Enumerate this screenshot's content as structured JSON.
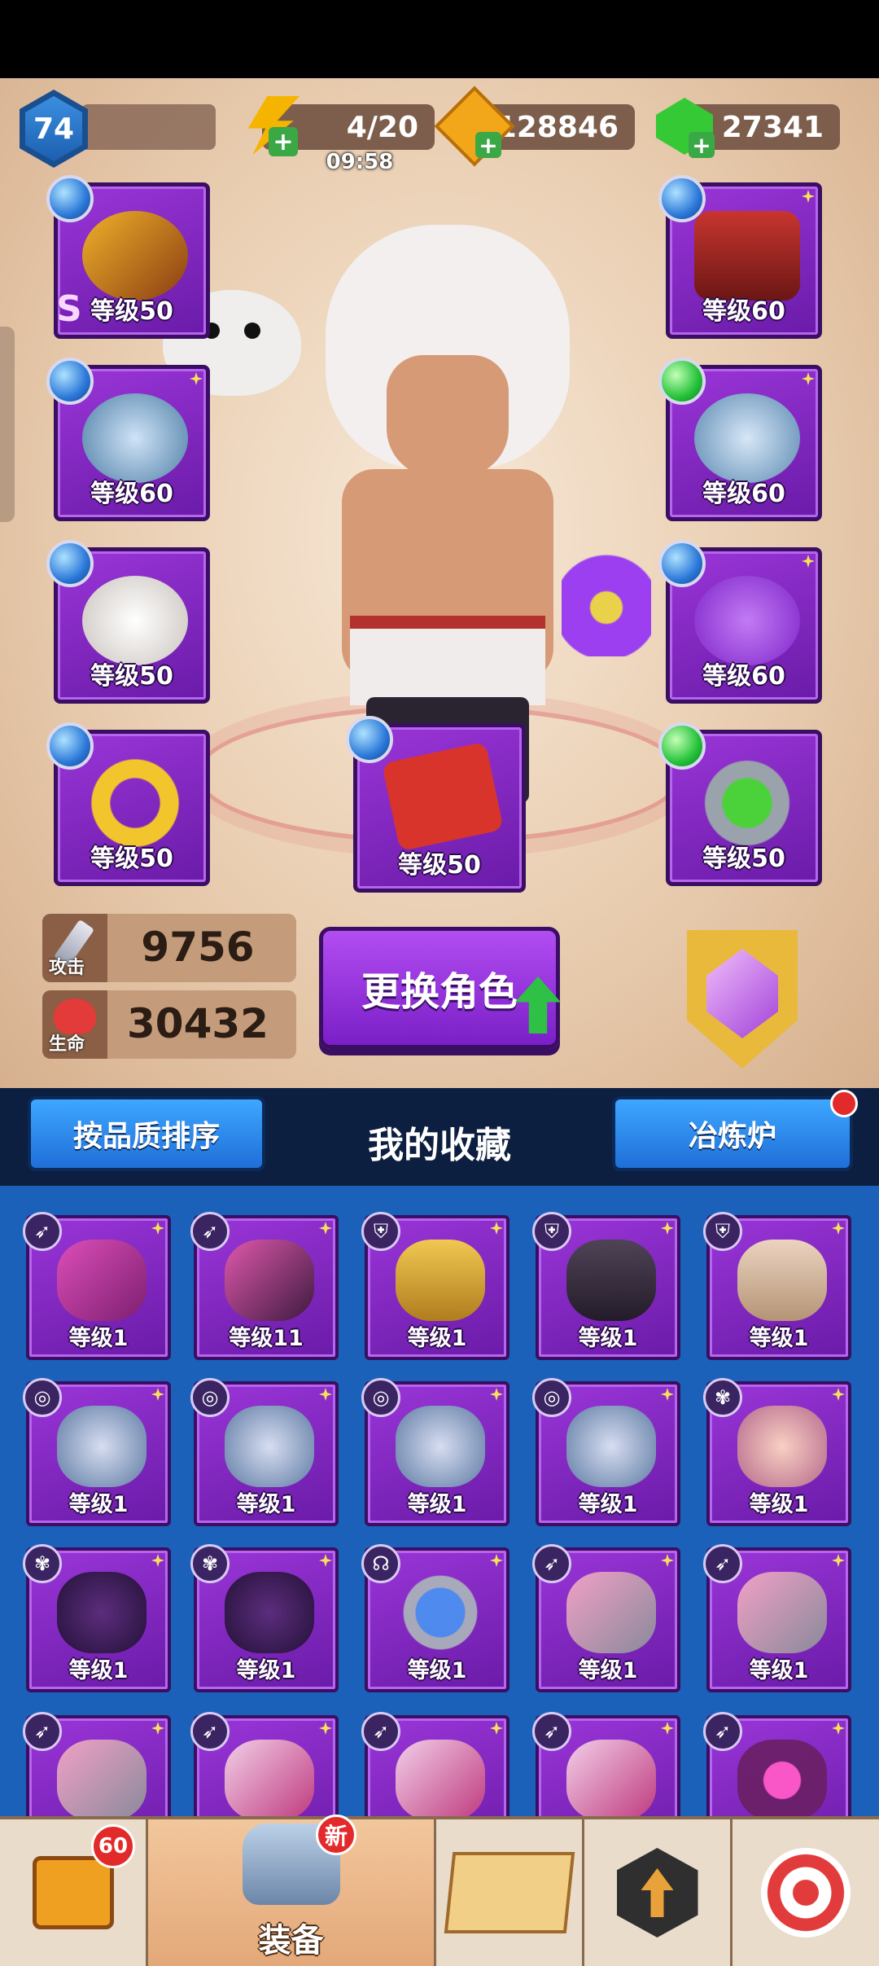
{
  "player": {
    "level": "74"
  },
  "resources": {
    "energy": "4/20",
    "energy_timer": "09:58",
    "coins": "128846",
    "gems": "27341"
  },
  "equipment": {
    "left": [
      {
        "level": "等级50",
        "rank": "S",
        "icon": "golden-bow-icon",
        "orb": "blue"
      },
      {
        "level": "等级60",
        "icon": "bull-ring-icon",
        "orb": "blue"
      },
      {
        "level": "等级50",
        "icon": "owl-pet-icon",
        "orb": "blue"
      },
      {
        "level": "等级50",
        "icon": "gold-ring-icon",
        "orb": "blue"
      }
    ],
    "right": [
      {
        "level": "等级60",
        "icon": "cape-armor-icon",
        "orb": "blue"
      },
      {
        "level": "等级60",
        "icon": "wolf-ring-icon",
        "orb": "green"
      },
      {
        "level": "等级60",
        "icon": "flame-pet-icon",
        "orb": "blue"
      },
      {
        "level": "等级50",
        "icon": "pendant-icon",
        "orb": "green"
      }
    ],
    "center": {
      "level": "等级50",
      "icon": "spellbook-icon",
      "orb": "blue"
    }
  },
  "stats": {
    "attack_label": "攻击",
    "attack_value": "9756",
    "hp_label": "生命",
    "hp_value": "30432"
  },
  "actions": {
    "switch_hero": "更换角色"
  },
  "collection": {
    "sort_button": "按品质排序",
    "title": "我的收藏",
    "smelter_button": "冶炼炉"
  },
  "items": [
    {
      "level": "等级1",
      "type": "bow",
      "icon": "pink-bow-icon"
    },
    {
      "level": "等级11",
      "type": "bow",
      "icon": "scythe-bow-icon"
    },
    {
      "level": "等级1",
      "type": "armor",
      "icon": "gold-armor-icon"
    },
    {
      "level": "等级1",
      "type": "armor",
      "icon": "dark-vest-icon"
    },
    {
      "level": "等级1",
      "type": "armor",
      "icon": "tan-armor-icon"
    },
    {
      "level": "等级1",
      "type": "ring",
      "icon": "bear-ring-icon"
    },
    {
      "level": "等级1",
      "type": "ring",
      "icon": "wolf-ring-icon"
    },
    {
      "level": "等级1",
      "type": "ring",
      "icon": "falcon-ring-icon"
    },
    {
      "level": "等级1",
      "type": "ring",
      "icon": "serpent-ring-icon"
    },
    {
      "level": "等级1",
      "type": "pet",
      "icon": "fairy-pet-icon"
    },
    {
      "level": "等级1",
      "type": "pet",
      "icon": "reaper-pet-icon"
    },
    {
      "level": "等级1",
      "type": "pet",
      "icon": "reaper-pet-icon"
    },
    {
      "level": "等级1",
      "type": "amulet",
      "icon": "eagle-amulet-icon"
    },
    {
      "level": "等级1",
      "type": "bow",
      "icon": "pink-sword-icon"
    },
    {
      "level": "等级1",
      "type": "bow",
      "icon": "pink-sword-icon"
    },
    {
      "level": "",
      "type": "bow",
      "icon": "pink-sword-icon"
    },
    {
      "level": "",
      "type": "bow",
      "icon": "pink-staff-icon"
    },
    {
      "level": "",
      "type": "bow",
      "icon": "pink-staff-icon"
    },
    {
      "level": "",
      "type": "bow",
      "icon": "pink-staff-icon"
    },
    {
      "level": "",
      "type": "bow",
      "icon": "magic-wand-icon"
    }
  ],
  "bottom_nav": {
    "chest_badge": "60",
    "equip_badge": "新",
    "equip_label": "装备"
  }
}
